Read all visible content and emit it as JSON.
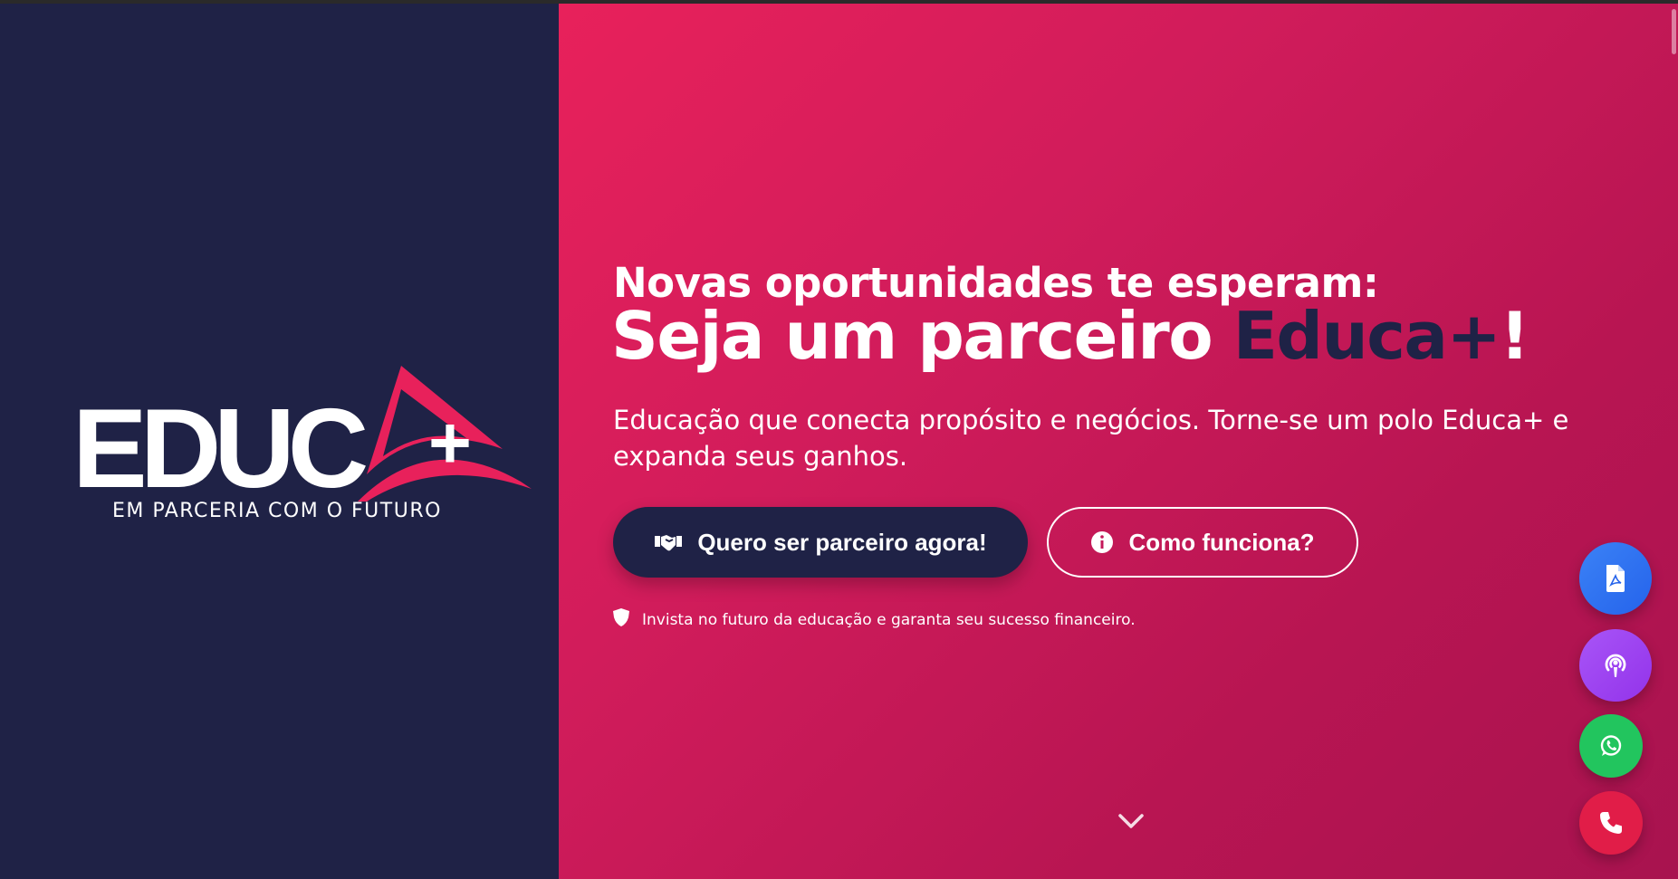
{
  "brand": {
    "logo_word": "EDUC",
    "logo_plus": "+",
    "logo_tagline": "EM PARCERIA COM O FUTURO",
    "colors": {
      "navy": "#1f2246",
      "pink": "#e8215b",
      "magenta_dark": "#a8134f",
      "white": "#ffffff"
    }
  },
  "hero": {
    "pre_title": "Novas oportunidades te esperam:",
    "headline_part1": "Seja um parceiro ",
    "headline_accent": "Educa+",
    "headline_end": "!",
    "lead": "Educação que conecta propósito e negócios. Torne-se um polo Educa+ e expanda seus ganhos.",
    "primary_button": {
      "label": "Quero ser parceiro agora!",
      "icon": "handshake-icon"
    },
    "secondary_button": {
      "label": "Como funciona?",
      "icon": "info-circle-icon"
    },
    "note": {
      "text": "Invista no futuro da educação e garanta seu sucesso financeiro.",
      "icon": "shield-icon"
    },
    "scroll_icon": "chevron-down-icon"
  },
  "floating_actions": [
    {
      "name": "pdf-button",
      "icon": "file-pdf-icon",
      "color": "#3b82f6"
    },
    {
      "name": "podcast-button",
      "icon": "podcast-icon",
      "color": "#a855f7"
    },
    {
      "name": "whatsapp-button",
      "icon": "whatsapp-icon",
      "color": "#22c55e"
    },
    {
      "name": "phone-button",
      "icon": "phone-icon",
      "color": "#e11d48"
    }
  ]
}
